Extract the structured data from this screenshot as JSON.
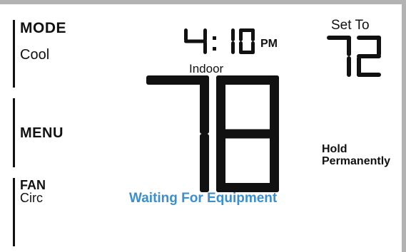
{
  "left_panel": {
    "mode_label": "MODE",
    "mode_value": "Cool",
    "menu_label": "MENU",
    "fan_label": "FAN",
    "fan_value": "Circ"
  },
  "clock": {
    "hour": "4",
    "minutes": "10",
    "meridiem": "PM"
  },
  "indoor": {
    "label": "Indoor",
    "temperature": "78"
  },
  "setpoint": {
    "label": "Set To",
    "temperature": "72"
  },
  "status": {
    "text": "Waiting For Equipment",
    "color": "#3b8fd1"
  },
  "hold": {
    "line1": "Hold",
    "line2": "Permanently"
  }
}
